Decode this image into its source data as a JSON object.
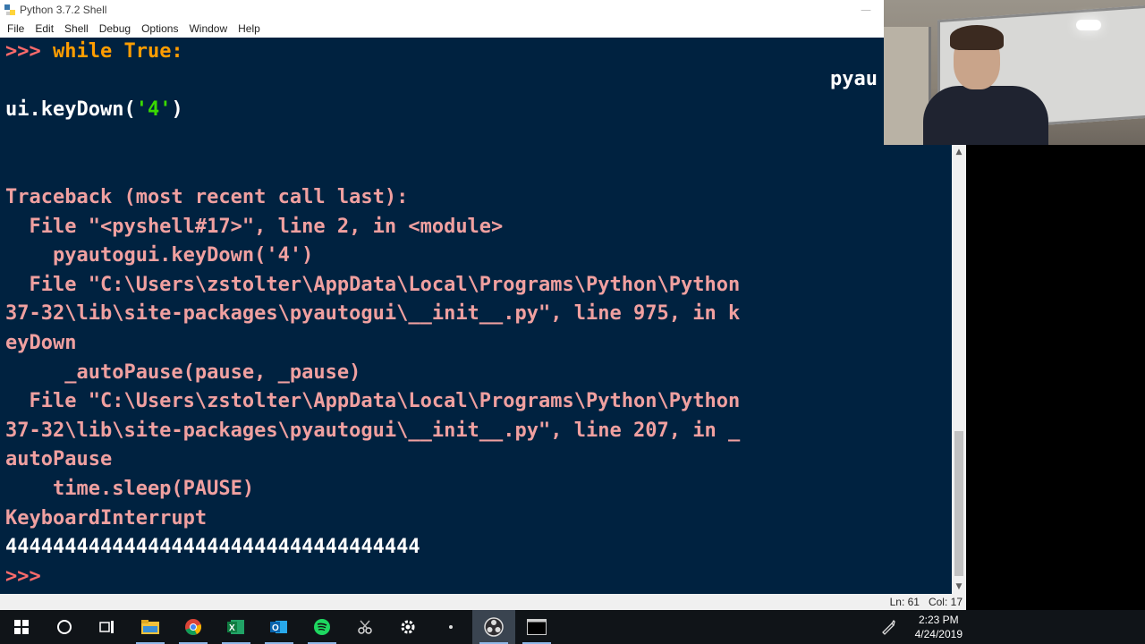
{
  "window": {
    "title": "Python 3.7.2 Shell"
  },
  "menu": {
    "items": [
      "File",
      "Edit",
      "Shell",
      "Debug",
      "Options",
      "Window",
      "Help"
    ]
  },
  "shell": {
    "prompt": ">>> ",
    "line1_keyword": "while True:",
    "right_fragment": "pyau",
    "line3_plain": "ui.keyDown(",
    "line3_string": "'4'",
    "line3_close": ")",
    "traceback": [
      "Traceback (most recent call last):",
      "  File \"<pyshell#17>\", line 2, in <module>",
      "    pyautogui.keyDown('4')",
      "  File \"C:\\Users\\zstolter\\AppData\\Local\\Programs\\Python\\Python",
      "37-32\\lib\\site-packages\\pyautogui\\__init__.py\", line 975, in k",
      "eyDown",
      "     _autoPause(pause, _pause)",
      "  File \"C:\\Users\\zstolter\\AppData\\Local\\Programs\\Python\\Python",
      "37-32\\lib\\site-packages\\pyautogui\\__init__.py\", line 207, in _",
      "autoPause",
      "    time.sleep(PAUSE)",
      "KeyboardInterrupt"
    ],
    "output": "44444444444444444444444444444444444",
    "final_prompt": ">>> "
  },
  "status": {
    "line": "Ln: 61",
    "col": "Col: 17"
  },
  "taskbar": {
    "time": "2:23 PM",
    "date": "4/24/2019",
    "apps": [
      "start-icon",
      "cortana-icon",
      "task-view-icon",
      "file-explorer-icon",
      "chrome-icon",
      "excel-icon",
      "outlook-icon",
      "spotify-icon",
      "snipping-icon",
      "settings-icon",
      "dot-app-icon",
      "obs-icon",
      "terminal-icon"
    ]
  },
  "colors": {
    "editor_bg": "#002240",
    "prompt": "#ff6b6b",
    "keyword": "#ff9d00",
    "string": "#3ad900",
    "error": "#f0a0a0"
  }
}
